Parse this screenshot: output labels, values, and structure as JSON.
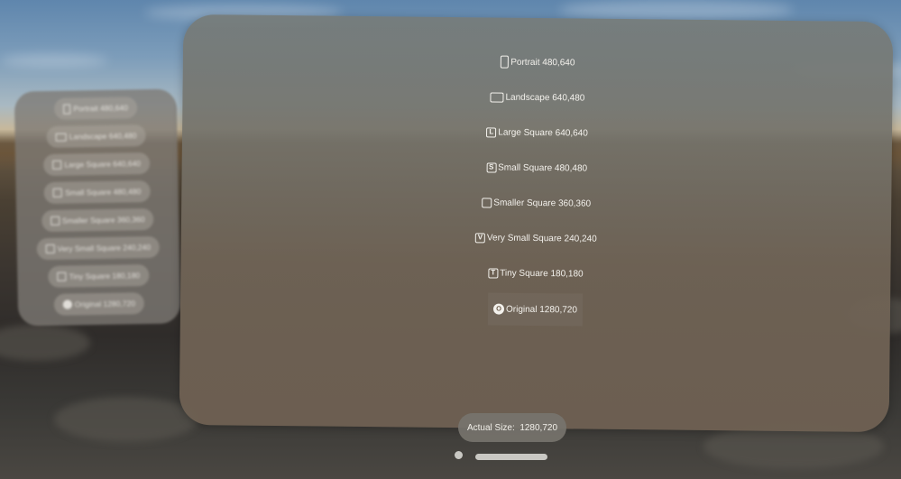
{
  "menu": {
    "items": [
      {
        "icon": "portrait-icon",
        "glyph": "",
        "label": "Portrait 480,640"
      },
      {
        "icon": "landscape-icon",
        "glyph": "",
        "label": "Landscape 640,480"
      },
      {
        "icon": "letter-l-icon",
        "glyph": "L",
        "label": "Large Square 640,640"
      },
      {
        "icon": "letter-s-icon",
        "glyph": "S",
        "label": "Small Square 480,480"
      },
      {
        "icon": "square-icon",
        "glyph": "",
        "label": "Smaller Square 360,360"
      },
      {
        "icon": "letter-v-icon",
        "glyph": "V",
        "label": "Very Small Square 240,240"
      },
      {
        "icon": "letter-t-icon",
        "glyph": "T",
        "label": "Tiny Square 180,180"
      },
      {
        "icon": "letter-o-circle-icon",
        "glyph": "O",
        "label": "Original 1280,720"
      }
    ]
  },
  "side_menu": {
    "items": [
      {
        "label": "Portrait 480,640"
      },
      {
        "label": "Landscape 640,480"
      },
      {
        "label": "Large Square 640,640"
      },
      {
        "label": "Small Square 480,480"
      },
      {
        "label": "Smaller Square 360,360"
      },
      {
        "label": "Very Small Square 240,240"
      },
      {
        "label": "Tiny Square 180,180"
      },
      {
        "label": "Original 1280,720"
      }
    ]
  },
  "status": {
    "size_text": "Actual Size:  1280,720"
  }
}
